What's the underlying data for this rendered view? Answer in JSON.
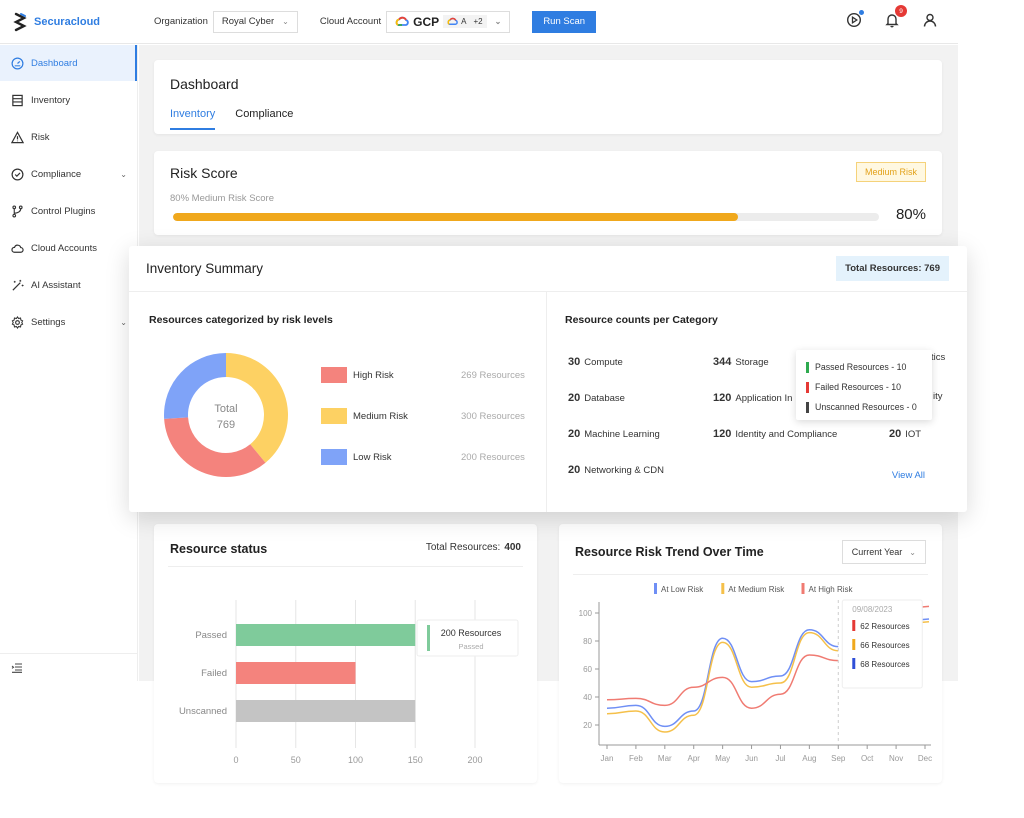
{
  "app": {
    "brand": "Securacloud"
  },
  "topbar": {
    "organization_label": "Organization",
    "organization_value": "Royal Cyber",
    "cloud_account_label": "Cloud Account",
    "cloud_account_primary": "GCP",
    "cloud_account_secondary": "A",
    "cloud_account_more": "+2",
    "run_scan_label": "Run Scan",
    "notification_count": "9"
  },
  "sidebar": {
    "items": [
      {
        "label": "Dashboard",
        "icon": "dashboard-gauge-icon",
        "active": true
      },
      {
        "label": "Inventory",
        "icon": "inventory-list-icon"
      },
      {
        "label": "Risk",
        "icon": "warning-triangle-icon"
      },
      {
        "label": "Compliance",
        "icon": "check-circle-icon",
        "expandable": true
      },
      {
        "label": "Control Plugins",
        "icon": "branch-icon"
      },
      {
        "label": "Cloud Accounts",
        "icon": "cloud-icon"
      },
      {
        "label": "AI Assistant",
        "icon": "magic-wand-icon"
      },
      {
        "label": "Settings",
        "icon": "gear-icon",
        "expandable": true
      }
    ]
  },
  "dashboard": {
    "title": "Dashboard",
    "tabs": [
      {
        "label": "Inventory",
        "active": true
      },
      {
        "label": "Compliance"
      }
    ]
  },
  "risk_score": {
    "title": "Risk Score",
    "badge": "Medium Risk",
    "subtitle": "80% Medium Risk Score",
    "percent_label": "80%",
    "value": 0.8,
    "colors": {
      "fill": "#f0a81c",
      "track": "#ececec"
    }
  },
  "inventory_summary": {
    "title": "Inventory Summary",
    "total_badge": "Total Resources: 769",
    "risk_section_title": "Resources categorized by risk levels",
    "donut_center_label": "Total",
    "donut_center_value": "769",
    "risk_levels": [
      {
        "label": "High Risk",
        "count_label": "269 Resources",
        "value": 269,
        "color": "#f4837d"
      },
      {
        "label": "Medium Risk",
        "count_label": "300 Resources",
        "value": 300,
        "color": "#fdd163"
      },
      {
        "label": "Low Risk",
        "count_label": "200 Resources",
        "value": 200,
        "color": "#7fa3f8"
      }
    ],
    "category_section_title": "Resource counts per Category",
    "categories": [
      {
        "count": "30",
        "name": "Compute"
      },
      {
        "count": "20",
        "name": "Database"
      },
      {
        "count": "20",
        "name": "Machine Learning"
      },
      {
        "count": "20",
        "name": "Networking & CDN"
      },
      {
        "count": "344",
        "name": "Storage"
      },
      {
        "count": "120",
        "name": "Application In"
      },
      {
        "count": "120",
        "name": "Identity and Compliance"
      },
      {
        "count": "",
        "name": "tics"
      },
      {
        "count": "",
        "name": "ity"
      },
      {
        "count": "20",
        "name": "IOT"
      }
    ],
    "view_all": "View All",
    "tooltip": [
      {
        "label": "Passed Resources - 10",
        "color": "#2eaa4f"
      },
      {
        "label": "Failed Resources - 10",
        "color": "#e53935"
      },
      {
        "label": "Unscanned Resources - 0",
        "color": "#444444"
      }
    ]
  },
  "resource_status": {
    "title": "Resource status",
    "total_label": "Total Resources:",
    "total_value": "400",
    "tooltip_value": "200 Resources",
    "tooltip_label": "Passed"
  },
  "risk_trend": {
    "title": "Resource Risk Trend Over Time",
    "period_select": "Current Year",
    "tooltip_date": "09/08/2023",
    "tooltip_rows": [
      {
        "label": "62 Resources",
        "color": "#e53935"
      },
      {
        "label": "66 Resources",
        "color": "#f0a81c"
      },
      {
        "label": "68 Resources",
        "color": "#2f4fd8"
      }
    ]
  },
  "chart_data": [
    {
      "type": "pie",
      "title": "Resources categorized by risk levels",
      "categories": [
        "High Risk",
        "Medium Risk",
        "Low Risk"
      ],
      "values": [
        269,
        300,
        200
      ],
      "center_text": "Total 769"
    },
    {
      "type": "bar",
      "orientation": "horizontal",
      "title": "Resource status",
      "categories": [
        "Passed",
        "Failed",
        "Unscanned"
      ],
      "values": [
        150,
        100,
        150
      ],
      "colors": [
        "#7fcb9b",
        "#f4837d",
        "#c4c4c4"
      ],
      "xlim": [
        0,
        200
      ],
      "xticks": [
        0,
        50,
        100,
        150,
        200
      ],
      "grid": true
    },
    {
      "type": "line",
      "title": "Resource Risk Trend Over Time",
      "x": [
        "Jan",
        "Feb",
        "Mar",
        "Apr",
        "May",
        "Jun",
        "Jul",
        "Aug",
        "Sep",
        "Oct",
        "Nov",
        "Dec"
      ],
      "ylim": [
        10,
        105
      ],
      "yticks": [
        20,
        40,
        60,
        80,
        100
      ],
      "legend": "top",
      "series": [
        {
          "name": "At Low Risk",
          "color": "#6f8ff5",
          "values": [
            32,
            34,
            19,
            30,
            82,
            51,
            55,
            88,
            76,
            null,
            null,
            95
          ]
        },
        {
          "name": "At Medium Risk",
          "color": "#f5c04a",
          "values": [
            28,
            30,
            15,
            27,
            79,
            47,
            50,
            86,
            73,
            null,
            null,
            93
          ]
        },
        {
          "name": "At High Risk",
          "color": "#f07b72",
          "values": [
            38,
            39,
            34,
            47,
            54,
            32,
            42,
            70,
            66,
            null,
            null,
            104
          ]
        }
      ]
    }
  ]
}
